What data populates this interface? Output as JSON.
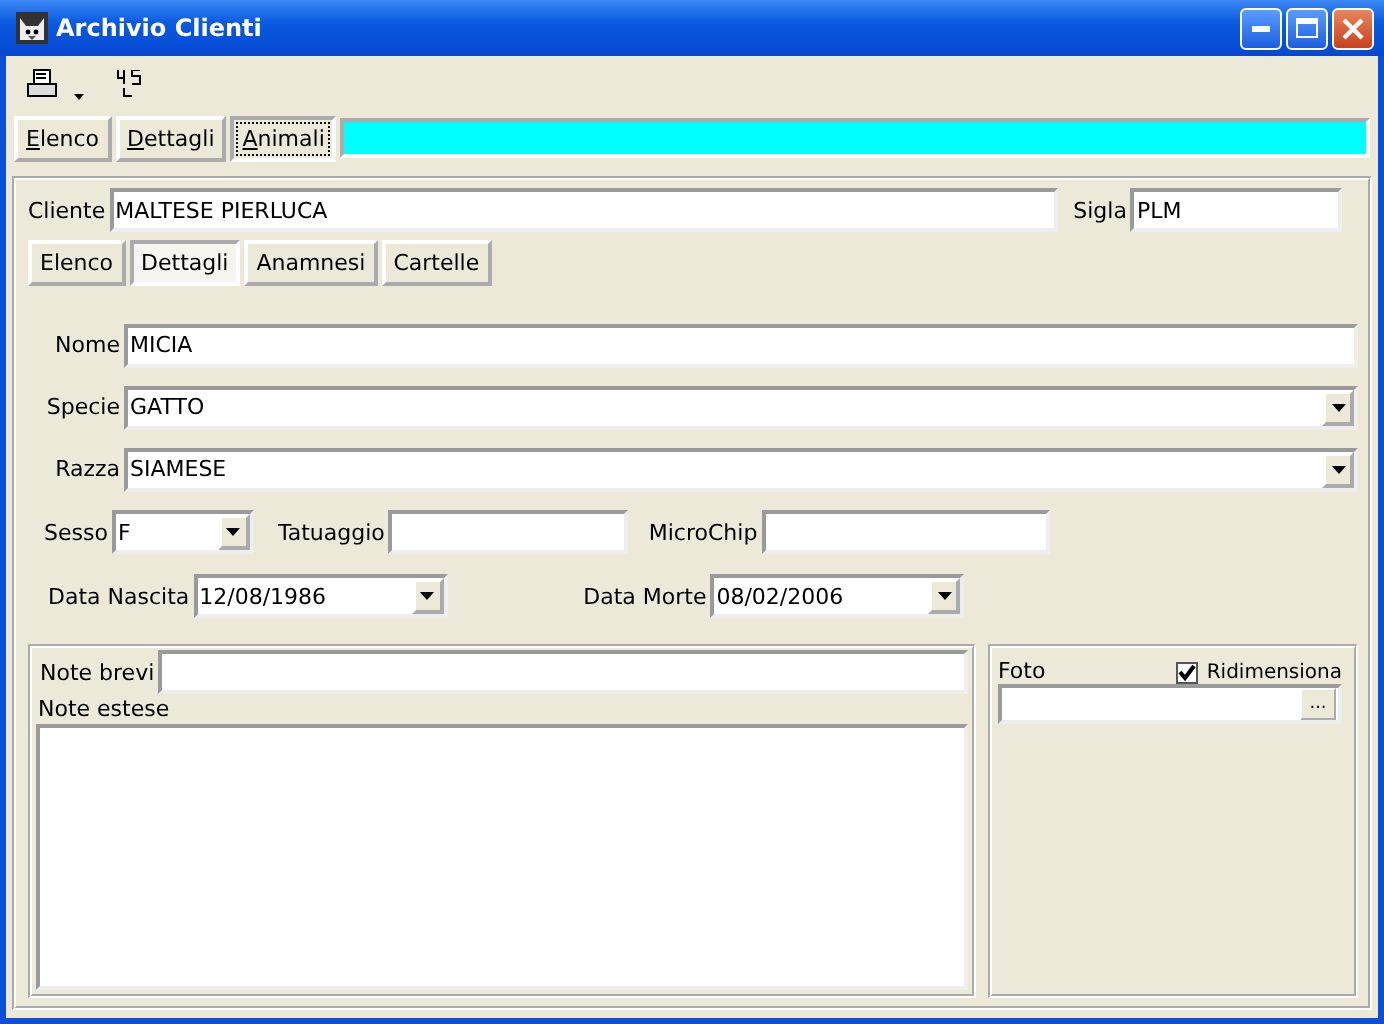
{
  "window": {
    "title": "Archivio Clienti"
  },
  "tabs": [
    {
      "label": "Elenco",
      "selected": false
    },
    {
      "label": "Dettagli",
      "selected": false
    },
    {
      "label": "Animali",
      "selected": true
    }
  ],
  "cliente": {
    "label": "Cliente",
    "value": "MALTESE PIERLUCA"
  },
  "sigla": {
    "label": "Sigla",
    "value": "PLM"
  },
  "subtabs": [
    {
      "label": "Elenco",
      "selected": false
    },
    {
      "label": "Dettagli",
      "selected": true
    },
    {
      "label": "Anamnesi",
      "selected": false
    },
    {
      "label": "Cartelle",
      "selected": false
    }
  ],
  "form_rows": [
    [
      {
        "kind": "text",
        "label": "Nome",
        "value": "MICIA"
      }
    ],
    [
      {
        "kind": "combo",
        "label": "Specie",
        "value": "GATTO"
      }
    ],
    [
      {
        "kind": "combo",
        "label": "Razza",
        "value": "SIAMESE"
      }
    ],
    [
      {
        "kind": "combo",
        "label": "Sesso",
        "value": "F"
      },
      {
        "kind": "text",
        "label": "Tatuaggio"
      },
      {
        "kind": "text",
        "label": "MicroChip"
      }
    ],
    [
      {
        "kind": "combo",
        "label": "Data Nascita",
        "value": "12/08/1986"
      },
      {
        "kind": "combo",
        "label": "Data Morte",
        "value": "08/02/2006"
      }
    ]
  ],
  "note_brevi": {
    "label": "Note brevi"
  },
  "note_estese": {
    "label": "Note estese"
  },
  "foto": {
    "label": "Foto",
    "button": "...",
    "resize": {
      "label": "Ridimensiona",
      "checked": true
    }
  }
}
